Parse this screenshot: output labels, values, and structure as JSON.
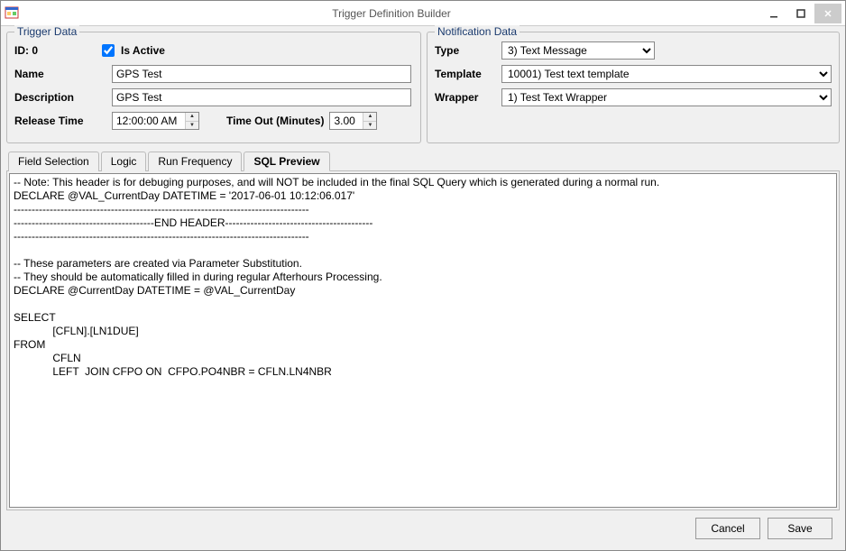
{
  "window": {
    "title": "Trigger Definition Builder"
  },
  "trigger": {
    "group_title": "Trigger Data",
    "id_label": "ID:",
    "id_value": "0",
    "is_active_label": "Is Active",
    "is_active_checked": true,
    "name_label": "Name",
    "name_value": "GPS Test",
    "desc_label": "Description",
    "desc_value": "GPS Test",
    "release_time_label": "Release Time",
    "release_time_value": "12:00:00 AM",
    "timeout_label": "Time Out  (Minutes)",
    "timeout_value": "3.00"
  },
  "notify": {
    "group_title": "Notification Data",
    "type_label": "Type",
    "type_value": "3) Text Message",
    "template_label": "Template",
    "template_value": "10001) Test text template",
    "wrapper_label": "Wrapper",
    "wrapper_value": "1) Test Text Wrapper"
  },
  "tabs": {
    "field_selection": "Field Selection",
    "logic": "Logic",
    "run_frequency": "Run Frequency",
    "sql_preview": "SQL Preview"
  },
  "sql_text": "-- Note: This header is for debuging purposes, and will NOT be included in the final SQL Query which is generated during a normal run.\nDECLARE @VAL_CurrentDay DATETIME = '2017-06-01 10:12:06.017'\n----------------------------------------------------------------------------------\n---------------------------------------END HEADER-----------------------------------------\n----------------------------------------------------------------------------------\n\n-- These parameters are created via Parameter Substitution.\n-- They should be automatically filled in during regular Afterhours Processing.\nDECLARE @CurrentDay DATETIME = @VAL_CurrentDay\n\nSELECT\n             [CFLN].[LN1DUE]\nFROM\n             CFLN \n             LEFT  JOIN CFPO ON  CFPO.PO4NBR = CFLN.LN4NBR",
  "footer": {
    "cancel": "Cancel",
    "save": "Save"
  }
}
